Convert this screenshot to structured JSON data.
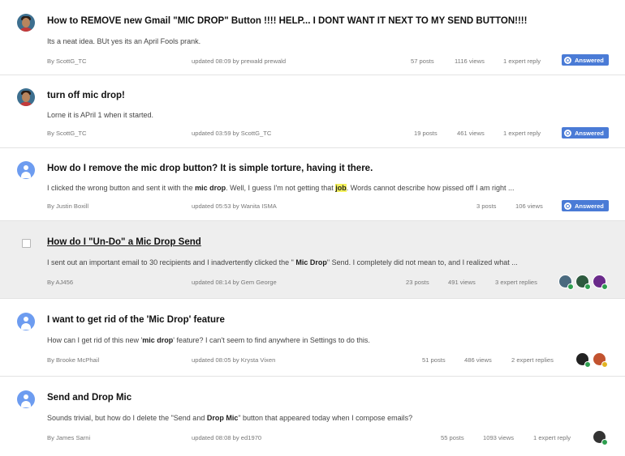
{
  "threads": [
    {
      "title": "How to REMOVE new Gmail \"MIC DROP\" Button !!!! HELP... I DONT WANT IT NEXT TO MY SEND BUTTON!!!!",
      "snippet": "Its a neat idea. BUt yes its an April Fools prank.",
      "author": "By ScottG_TC",
      "updated": "updated 08:09 by prewald prewald",
      "posts": "57 posts",
      "views": "1116 views",
      "replies": "1 expert reply",
      "badge": "Answered"
    },
    {
      "title": "turn off mic drop!",
      "snippet": "Lorne it is APril 1 when it started.",
      "author": "By ScottG_TC",
      "updated": "updated 03:59 by ScottG_TC",
      "posts": "19 posts",
      "views": "461 views",
      "replies": "1 expert reply",
      "badge": "Answered"
    },
    {
      "title": "How do I remove the mic drop button? It is simple torture, having it there.",
      "snippet_parts": [
        "I clicked the wrong button and sent it with the ",
        "mic drop",
        ". Well, I guess I'm not getting that ",
        "job",
        ". Words cannot describe how pissed off I am right ..."
      ],
      "author": "By Justin Boxill",
      "updated": "updated 05:53 by Wanita ISMA",
      "posts": "3 posts",
      "views": "106 views",
      "badge": "Answered"
    },
    {
      "title": "How do I \"Un-Do\" a Mic Drop Send",
      "snippet_parts": [
        "I sent out an important email to 30 recipients and I inadvertently clicked the \" ",
        "Mic Drop",
        "\" Send. I completely did not mean to, and I realized what ..."
      ],
      "author": "By AJ456",
      "updated": "updated 08:14 by Gem George",
      "posts": "23 posts",
      "views": "491 views",
      "replies": "3 expert replies"
    },
    {
      "title": "I want to get rid of the 'Mic Drop' feature",
      "snippet_parts": [
        "How can I get rid of this new '",
        "mic drop",
        "' feature? I can't seem to find anywhere in Settings to do this."
      ],
      "author": "By Brooke McPhail",
      "updated": "updated 08:05 by Krysta Vixen",
      "posts": "51 posts",
      "views": "486 views",
      "replies": "2 expert replies"
    },
    {
      "title": "Send and Drop Mic",
      "snippet_parts": [
        "Sounds trivial, but how do I delete the \"Send and ",
        "Drop Mic",
        "\" button that appeared today when I compose emails?"
      ],
      "author": "By James Sarni",
      "updated": "updated 08:08 by ed1970",
      "posts": "55 posts",
      "views": "1093 views",
      "replies": "1 expert reply"
    }
  ],
  "colors": {
    "answered_badge": "#4a7bd6",
    "highlight": "#f5f25c",
    "row_hover": "#eeeeee",
    "generic_avatar": "#6d9cf0"
  }
}
